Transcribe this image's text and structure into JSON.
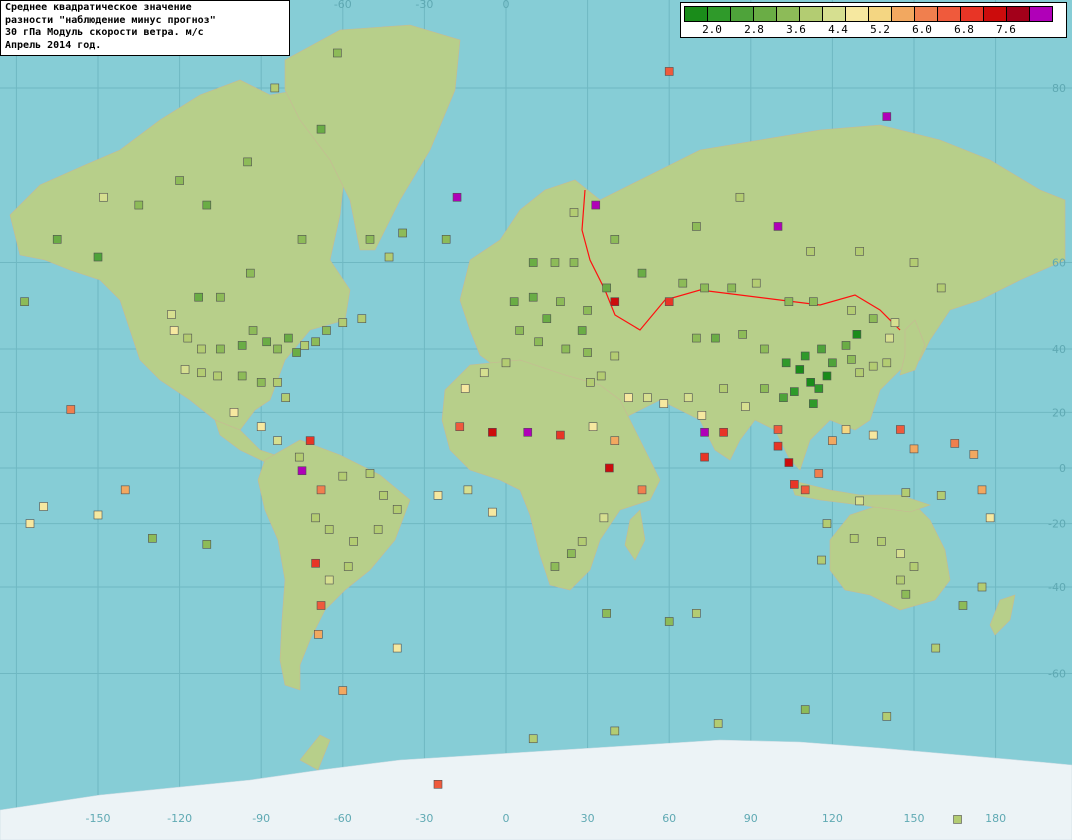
{
  "title_lines": [
    "Среднее квадратическое значение",
    "разности \"наблюдение минус прогноз\"",
    "30 гПа Модуль скорости ветра. м/с",
    "Апрель 2014 год."
  ],
  "legend": {
    "colors": [
      "#1a8c1a",
      "#2f9a2a",
      "#4ea33a",
      "#6aad45",
      "#8dbb58",
      "#b3cc72",
      "#d6df90",
      "#f6e8a0",
      "#f4d682",
      "#f2a860",
      "#f07f4e",
      "#ef5a3c",
      "#e83526",
      "#cc0c0c",
      "#a3001a",
      "#b000b8"
    ],
    "tick_labels": [
      "2.0",
      "2.8",
      "3.6",
      "4.4",
      "5.2",
      "6.0",
      "6.8",
      "7.6"
    ]
  },
  "axes": {
    "lon_labels": [
      "-150",
      "-120",
      "-90",
      "-60",
      "-30",
      "0",
      "30",
      "60",
      "90",
      "120",
      "150",
      "180"
    ],
    "lat_labels": [
      "80",
      "60",
      "40",
      "20",
      "0",
      "-20",
      "-40",
      "-60"
    ],
    "top_lon_labels": [
      "-60",
      "-30",
      "0"
    ]
  },
  "chart_data": {
    "type": "scatter",
    "title": "Среднее квадратическое значение разности \"наблюдение минус прогноз\" 30 гПа Модуль скорости ветра. м/с Апрель 2014 год.",
    "legend_ticks": [
      2.0,
      2.8,
      3.6,
      4.4,
      5.2,
      6.0,
      6.8,
      7.6
    ],
    "color_bins": 16,
    "xlim": [
      -180,
      180
    ],
    "ylim": [
      -80,
      85
    ],
    "projection": "mercator",
    "stations": [
      {
        "lon": -148,
        "lat": 70,
        "v": 4.2
      },
      {
        "lon": -135,
        "lat": 69,
        "v": 3.4
      },
      {
        "lon": -120,
        "lat": 72,
        "v": 3.2
      },
      {
        "lon": -110,
        "lat": 69,
        "v": 3.0
      },
      {
        "lon": -95,
        "lat": 74,
        "v": 3.4
      },
      {
        "lon": -85,
        "lat": 80,
        "v": 3.6
      },
      {
        "lon": -62,
        "lat": 82,
        "v": 3.4
      },
      {
        "lon": -68,
        "lat": 77,
        "v": 3.0
      },
      {
        "lon": -75,
        "lat": 64,
        "v": 3.4
      },
      {
        "lon": -94,
        "lat": 58,
        "v": 3.5
      },
      {
        "lon": -105,
        "lat": 53,
        "v": 3.4
      },
      {
        "lon": -113,
        "lat": 53,
        "v": 3.0
      },
      {
        "lon": -123,
        "lat": 49,
        "v": 4.2
      },
      {
        "lon": -122,
        "lat": 45,
        "v": 4.4
      },
      {
        "lon": -117,
        "lat": 43,
        "v": 3.8
      },
      {
        "lon": -112,
        "lat": 40,
        "v": 3.6
      },
      {
        "lon": -105,
        "lat": 40,
        "v": 3.4
      },
      {
        "lon": -97,
        "lat": 41,
        "v": 3.0
      },
      {
        "lon": -93,
        "lat": 45,
        "v": 3.2
      },
      {
        "lon": -88,
        "lat": 42,
        "v": 3.0
      },
      {
        "lon": -84,
        "lat": 40,
        "v": 3.2
      },
      {
        "lon": -80,
        "lat": 43,
        "v": 2.9
      },
      {
        "lon": -77,
        "lat": 39,
        "v": 3.0
      },
      {
        "lon": -74,
        "lat": 41,
        "v": 3.6
      },
      {
        "lon": -70,
        "lat": 42,
        "v": 3.4
      },
      {
        "lon": -66,
        "lat": 45,
        "v": 3.2
      },
      {
        "lon": -60,
        "lat": 47,
        "v": 3.6
      },
      {
        "lon": -53,
        "lat": 48,
        "v": 3.8
      },
      {
        "lon": -97,
        "lat": 32,
        "v": 3.4
      },
      {
        "lon": -90,
        "lat": 30,
        "v": 3.2
      },
      {
        "lon": -84,
        "lat": 30,
        "v": 3.6
      },
      {
        "lon": -81,
        "lat": 25,
        "v": 3.8
      },
      {
        "lon": -106,
        "lat": 32,
        "v": 3.6
      },
      {
        "lon": -112,
        "lat": 33,
        "v": 4.0
      },
      {
        "lon": -118,
        "lat": 34,
        "v": 4.2
      },
      {
        "lon": -100,
        "lat": 20,
        "v": 4.4
      },
      {
        "lon": -90,
        "lat": 15,
        "v": 4.6
      },
      {
        "lon": -84,
        "lat": 10,
        "v": 4.2
      },
      {
        "lon": -76,
        "lat": 4,
        "v": 3.8
      },
      {
        "lon": -72,
        "lat": 10,
        "v": 6.8
      },
      {
        "lon": -75,
        "lat": -1,
        "v": 7.6
      },
      {
        "lon": -68,
        "lat": -8,
        "v": 5.8
      },
      {
        "lon": -60,
        "lat": -3,
        "v": 3.6
      },
      {
        "lon": -50,
        "lat": -2,
        "v": 4.0
      },
      {
        "lon": -45,
        "lat": -10,
        "v": 3.6
      },
      {
        "lon": -40,
        "lat": -15,
        "v": 3.8
      },
      {
        "lon": -47,
        "lat": -22,
        "v": 3.6
      },
      {
        "lon": -56,
        "lat": -26,
        "v": 3.8
      },
      {
        "lon": -65,
        "lat": -22,
        "v": 4.0
      },
      {
        "lon": -70,
        "lat": -18,
        "v": 3.6
      },
      {
        "lon": -58,
        "lat": -34,
        "v": 3.6
      },
      {
        "lon": -65,
        "lat": -38,
        "v": 4.2
      },
      {
        "lon": -70,
        "lat": -33,
        "v": 6.6
      },
      {
        "lon": -68,
        "lat": -45,
        "v": 6.0
      },
      {
        "lon": -69,
        "lat": -52,
        "v": 5.6
      },
      {
        "lon": -60,
        "lat": -63,
        "v": 5.6
      },
      {
        "lon": -22,
        "lat": 64,
        "v": 3.2
      },
      {
        "lon": -18,
        "lat": 70,
        "v": 7.6
      },
      {
        "lon": -38,
        "lat": 65,
        "v": 3.4
      },
      {
        "lon": -50,
        "lat": 64,
        "v": 3.2
      },
      {
        "lon": -43,
        "lat": 61,
        "v": 3.6
      },
      {
        "lon": -15,
        "lat": 28,
        "v": 4.4
      },
      {
        "lon": -17,
        "lat": 15,
        "v": 6.0
      },
      {
        "lon": -5,
        "lat": 13,
        "v": 7.0
      },
      {
        "lon": 8,
        "lat": 13,
        "v": 7.6
      },
      {
        "lon": 20,
        "lat": 12,
        "v": 6.4
      },
      {
        "lon": -8,
        "lat": 33,
        "v": 4.2
      },
      {
        "lon": 0,
        "lat": 36,
        "v": 3.6
      },
      {
        "lon": 3,
        "lat": 52,
        "v": 3.0
      },
      {
        "lon": 10,
        "lat": 53,
        "v": 3.0
      },
      {
        "lon": 20,
        "lat": 52,
        "v": 3.2
      },
      {
        "lon": 15,
        "lat": 48,
        "v": 3.0
      },
      {
        "lon": 5,
        "lat": 45,
        "v": 3.4
      },
      {
        "lon": 12,
        "lat": 42,
        "v": 3.2
      },
      {
        "lon": 22,
        "lat": 40,
        "v": 3.4
      },
      {
        "lon": 28,
        "lat": 45,
        "v": 3.0
      },
      {
        "lon": 30,
        "lat": 50,
        "v": 3.2
      },
      {
        "lon": 37,
        "lat": 55,
        "v": 3.0
      },
      {
        "lon": 25,
        "lat": 60,
        "v": 3.4
      },
      {
        "lon": 18,
        "lat": 60,
        "v": 3.2
      },
      {
        "lon": 10,
        "lat": 60,
        "v": 3.0
      },
      {
        "lon": 25,
        "lat": 68,
        "v": 3.6
      },
      {
        "lon": 33,
        "lat": 69,
        "v": 7.6
      },
      {
        "lon": 30,
        "lat": 39,
        "v": 3.4
      },
      {
        "lon": 40,
        "lat": 38,
        "v": 3.6
      },
      {
        "lon": 35,
        "lat": 32,
        "v": 4.0
      },
      {
        "lon": 31,
        "lat": 30,
        "v": 3.8
      },
      {
        "lon": 32,
        "lat": 15,
        "v": 4.8
      },
      {
        "lon": 40,
        "lat": 10,
        "v": 5.6
      },
      {
        "lon": 38,
        "lat": 0,
        "v": 7.0
      },
      {
        "lon": 45,
        "lat": 25,
        "v": 4.4
      },
      {
        "lon": 52,
        "lat": 25,
        "v": 4.2
      },
      {
        "lon": 50,
        "lat": -8,
        "v": 5.8
      },
      {
        "lon": 36,
        "lat": -18,
        "v": 4.2
      },
      {
        "lon": 28,
        "lat": -26,
        "v": 3.6
      },
      {
        "lon": 18,
        "lat": -34,
        "v": 3.4
      },
      {
        "lon": 24,
        "lat": -30,
        "v": 3.2
      },
      {
        "lon": 58,
        "lat": 23,
        "v": 4.4
      },
      {
        "lon": 67,
        "lat": 25,
        "v": 4.2
      },
      {
        "lon": 72,
        "lat": 19,
        "v": 4.6
      },
      {
        "lon": 73,
        "lat": 13,
        "v": 7.6
      },
      {
        "lon": 80,
        "lat": 13,
        "v": 6.8
      },
      {
        "lon": 73,
        "lat": 4,
        "v": 6.4
      },
      {
        "lon": 80,
        "lat": 28,
        "v": 3.6
      },
      {
        "lon": 88,
        "lat": 22,
        "v": 4.2
      },
      {
        "lon": 95,
        "lat": 28,
        "v": 3.2
      },
      {
        "lon": 100,
        "lat": 14,
        "v": 6.0
      },
      {
        "lon": 100,
        "lat": 8,
        "v": 6.8
      },
      {
        "lon": 104,
        "lat": 2,
        "v": 7.2
      },
      {
        "lon": 106,
        "lat": -6,
        "v": 6.4
      },
      {
        "lon": 110,
        "lat": -8,
        "v": 6.0
      },
      {
        "lon": 115,
        "lat": -2,
        "v": 5.8
      },
      {
        "lon": 120,
        "lat": 10,
        "v": 5.2
      },
      {
        "lon": 125,
        "lat": 14,
        "v": 5.0
      },
      {
        "lon": 135,
        "lat": 12,
        "v": 4.6
      },
      {
        "lon": 145,
        "lat": 14,
        "v": 6.0
      },
      {
        "lon": 150,
        "lat": 7,
        "v": 5.6
      },
      {
        "lon": 165,
        "lat": 9,
        "v": 5.8
      },
      {
        "lon": 172,
        "lat": 5,
        "v": 5.6
      },
      {
        "lon": 175,
        "lat": -8,
        "v": 5.4
      },
      {
        "lon": 178,
        "lat": -18,
        "v": 4.4
      },
      {
        "lon": 160,
        "lat": -10,
        "v": 3.6
      },
      {
        "lon": 147,
        "lat": -9,
        "v": 4.0
      },
      {
        "lon": 130,
        "lat": -12,
        "v": 4.2
      },
      {
        "lon": 118,
        "lat": -20,
        "v": 3.8
      },
      {
        "lon": 128,
        "lat": -25,
        "v": 4.0
      },
      {
        "lon": 138,
        "lat": -26,
        "v": 3.8
      },
      {
        "lon": 145,
        "lat": -30,
        "v": 4.2
      },
      {
        "lon": 150,
        "lat": -34,
        "v": 3.6
      },
      {
        "lon": 145,
        "lat": -38,
        "v": 3.8
      },
      {
        "lon": 116,
        "lat": -32,
        "v": 3.6
      },
      {
        "lon": 147,
        "lat": -42,
        "v": 3.4
      },
      {
        "lon": 168,
        "lat": -45,
        "v": 3.4
      },
      {
        "lon": 175,
        "lat": -40,
        "v": 3.6
      },
      {
        "lon": 158,
        "lat": -55,
        "v": 3.6
      },
      {
        "lon": 65,
        "lat": 56,
        "v": 3.4
      },
      {
        "lon": 73,
        "lat": 55,
        "v": 3.2
      },
      {
        "lon": 83,
        "lat": 55,
        "v": 3.4
      },
      {
        "lon": 92,
        "lat": 56,
        "v": 3.6
      },
      {
        "lon": 104,
        "lat": 52,
        "v": 3.2
      },
      {
        "lon": 113,
        "lat": 52,
        "v": 3.4
      },
      {
        "lon": 127,
        "lat": 50,
        "v": 3.6
      },
      {
        "lon": 135,
        "lat": 48,
        "v": 3.4
      },
      {
        "lon": 70,
        "lat": 66,
        "v": 3.4
      },
      {
        "lon": 86,
        "lat": 70,
        "v": 3.6
      },
      {
        "lon": 100,
        "lat": 66,
        "v": 7.6
      },
      {
        "lon": 112,
        "lat": 62,
        "v": 3.6
      },
      {
        "lon": 130,
        "lat": 62,
        "v": 3.8
      },
      {
        "lon": 150,
        "lat": 60,
        "v": 3.6
      },
      {
        "lon": 160,
        "lat": 55,
        "v": 4.0
      },
      {
        "lon": 143,
        "lat": 47,
        "v": 4.2
      },
      {
        "lon": 140,
        "lat": 78,
        "v": 7.6
      },
      {
        "lon": 60,
        "lat": 81,
        "v": 6.0
      },
      {
        "lon": 40,
        "lat": 64,
        "v": 3.2
      },
      {
        "lon": 50,
        "lat": 58,
        "v": 3.0
      },
      {
        "lon": 40,
        "lat": 52,
        "v": 7.0
      },
      {
        "lon": 60,
        "lat": 52,
        "v": 6.8
      },
      {
        "lon": 70,
        "lat": 43,
        "v": 3.2
      },
      {
        "lon": 77,
        "lat": 43,
        "v": 3.0
      },
      {
        "lon": 87,
        "lat": 44,
        "v": 3.2
      },
      {
        "lon": 95,
        "lat": 40,
        "v": 3.4
      },
      {
        "lon": 103,
        "lat": 36,
        "v": 2.4
      },
      {
        "lon": 108,
        "lat": 34,
        "v": 2.0
      },
      {
        "lon": 112,
        "lat": 30,
        "v": 2.0
      },
      {
        "lon": 115,
        "lat": 28,
        "v": 2.2
      },
      {
        "lon": 118,
        "lat": 32,
        "v": 2.0
      },
      {
        "lon": 113,
        "lat": 23,
        "v": 2.2
      },
      {
        "lon": 106,
        "lat": 27,
        "v": 2.4
      },
      {
        "lon": 102,
        "lat": 25,
        "v": 2.6
      },
      {
        "lon": 110,
        "lat": 38,
        "v": 2.4
      },
      {
        "lon": 116,
        "lat": 40,
        "v": 2.6
      },
      {
        "lon": 120,
        "lat": 36,
        "v": 2.8
      },
      {
        "lon": 125,
        "lat": 41,
        "v": 3.0
      },
      {
        "lon": 127,
        "lat": 37,
        "v": 3.4
      },
      {
        "lon": 130,
        "lat": 33,
        "v": 3.6
      },
      {
        "lon": 135,
        "lat": 35,
        "v": 3.8
      },
      {
        "lon": 140,
        "lat": 36,
        "v": 4.0
      },
      {
        "lon": 141,
        "lat": 43,
        "v": 4.2
      },
      {
        "lon": 129,
        "lat": 44,
        "v": 2.0
      },
      {
        "lon": -160,
        "lat": 21,
        "v": 5.8
      },
      {
        "lon": -150,
        "lat": 61,
        "v": 2.8
      },
      {
        "lon": -165,
        "lat": 64,
        "v": 3.0
      },
      {
        "lon": -177,
        "lat": 52,
        "v": 3.2
      },
      {
        "lon": -140,
        "lat": -8,
        "v": 5.6
      },
      {
        "lon": -150,
        "lat": -17,
        "v": 4.6
      },
      {
        "lon": -130,
        "lat": -25,
        "v": 3.4
      },
      {
        "lon": -110,
        "lat": -27,
        "v": 3.2
      },
      {
        "lon": -175,
        "lat": -20,
        "v": 4.8
      },
      {
        "lon": -170,
        "lat": -14,
        "v": 4.4
      },
      {
        "lon": -25,
        "lat": -10,
        "v": 4.4
      },
      {
        "lon": -5,
        "lat": -16,
        "v": 4.4
      },
      {
        "lon": -14,
        "lat": -8,
        "v": 4.2
      },
      {
        "lon": -40,
        "lat": -55,
        "v": 4.6
      },
      {
        "lon": 10,
        "lat": -70,
        "v": 4.0
      },
      {
        "lon": 40,
        "lat": -69,
        "v": 3.8
      },
      {
        "lon": 78,
        "lat": -68,
        "v": 3.6
      },
      {
        "lon": 110,
        "lat": -66,
        "v": 3.4
      },
      {
        "lon": 140,
        "lat": -67,
        "v": 3.6
      },
      {
        "lon": 166,
        "lat": -78,
        "v": 3.8
      },
      {
        "lon": -25,
        "lat": -75,
        "v": 6.2
      },
      {
        "lon": 60,
        "lat": -49,
        "v": 3.4
      },
      {
        "lon": 70,
        "lat": -47,
        "v": 3.6
      },
      {
        "lon": 37,
        "lat": -47,
        "v": 3.4
      }
    ]
  }
}
